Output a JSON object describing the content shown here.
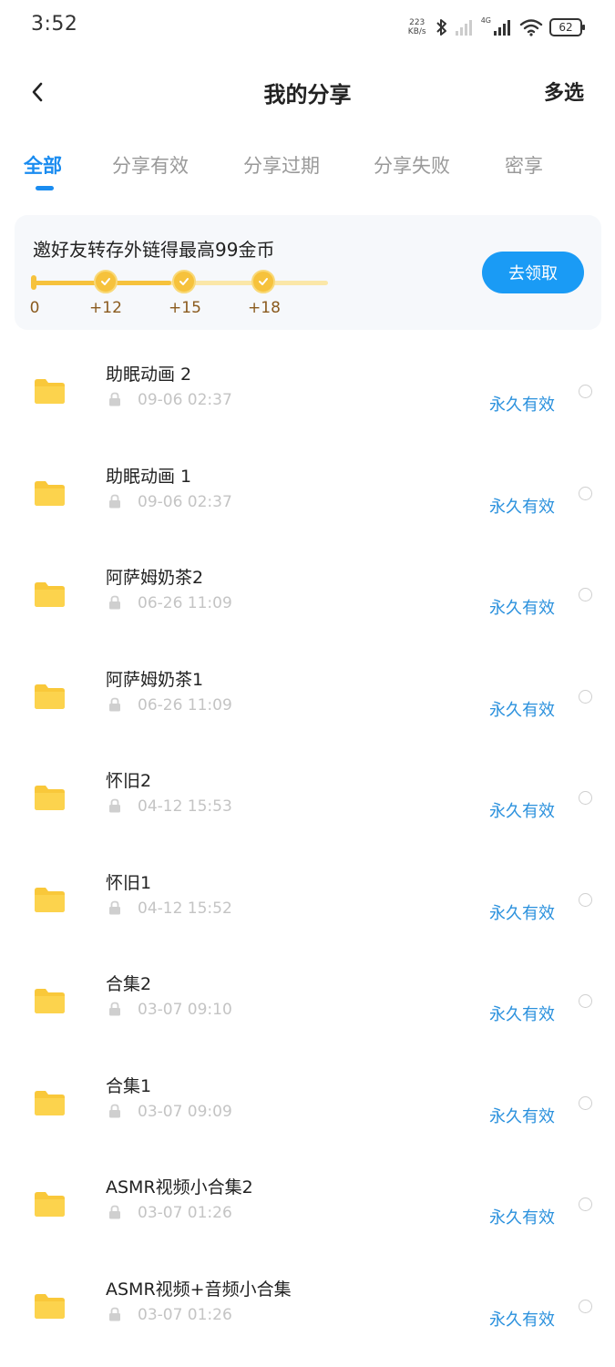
{
  "status_bar": {
    "time": "3:52",
    "net_speed_value": "223",
    "net_speed_unit": "KB/s",
    "network_label": "4G",
    "battery": "62"
  },
  "header": {
    "title": "我的分享",
    "multi_select": "多选"
  },
  "tabs": [
    {
      "label": "全部",
      "active": true
    },
    {
      "label": "分享有效",
      "active": false
    },
    {
      "label": "分享过期",
      "active": false
    },
    {
      "label": "分享失败",
      "active": false
    },
    {
      "label": "密享",
      "active": false
    }
  ],
  "banner": {
    "title": "邀好友转存外链得最高99金币",
    "rewards": [
      "0",
      "+12",
      "+15",
      "+18"
    ],
    "progress": 0.47,
    "button_label": "去领取",
    "accent_color": "#1a9bf5"
  },
  "share_items": [
    {
      "name": "助眠动画 2",
      "date": "09-06 02:37",
      "status": "永久有效"
    },
    {
      "name": "助眠动画 1",
      "date": "09-06 02:37",
      "status": "永久有效"
    },
    {
      "name": "阿萨姆奶茶2",
      "date": "06-26 11:09",
      "status": "永久有效"
    },
    {
      "name": "阿萨姆奶茶1",
      "date": "06-26 11:09",
      "status": "永久有效"
    },
    {
      "name": "怀旧2",
      "date": "04-12 15:53",
      "status": "永久有效"
    },
    {
      "name": "怀旧1",
      "date": "04-12 15:52",
      "status": "永久有效"
    },
    {
      "name": "合集2",
      "date": "03-07 09:10",
      "status": "永久有效"
    },
    {
      "name": "合集1",
      "date": "03-07 09:09",
      "status": "永久有效"
    },
    {
      "name": "ASMR视频小合集2",
      "date": "03-07 01:26",
      "status": "永久有效"
    },
    {
      "name": "ASMR视频+音频小合集",
      "date": "03-07 01:26",
      "status": "永久有效"
    }
  ]
}
